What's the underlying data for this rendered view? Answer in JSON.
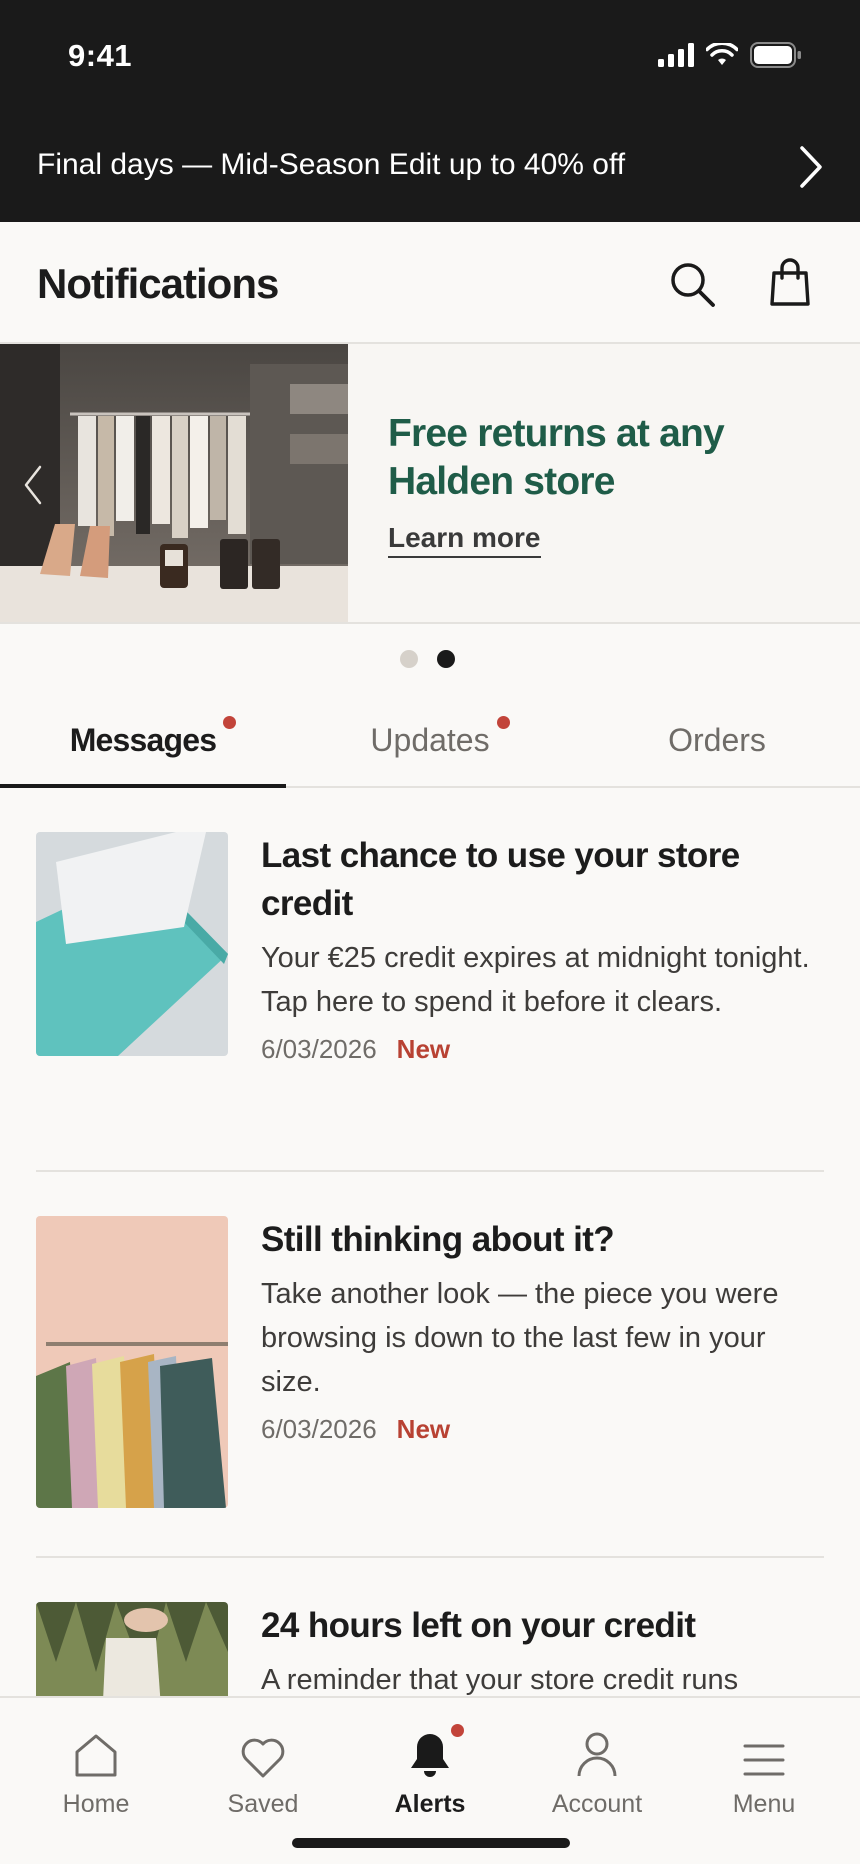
{
  "status_bar": {
    "time": "9:41"
  },
  "promo_bar": {
    "text": "Final days — Mid-Season Edit up to 40% off"
  },
  "header": {
    "title": "Notifications"
  },
  "banner": {
    "headline": "Free returns at any Halden store",
    "link_label": "Learn more",
    "slide_count": 2,
    "active_slide": 2
  },
  "tabs": [
    {
      "label": "Messages",
      "active": true,
      "unread": true
    },
    {
      "label": "Updates",
      "active": false,
      "unread": true
    },
    {
      "label": "Orders",
      "active": false,
      "unread": false
    }
  ],
  "notifications": [
    {
      "title": "Last chance to use your store credit",
      "body": "Your €25 credit expires at midnight tonight. Tap here to spend it before it clears.",
      "date": "6/03/2026",
      "badge": "New",
      "image": "teal-gift-box-with-card"
    },
    {
      "title": "Still thinking about it?",
      "body": "Take another look — the piece you were browsing is down to the last few in your size.",
      "date": "6/03/2026",
      "badge": "New",
      "image": "clothing-rail-pink-wall"
    },
    {
      "title": "24 hours left on your credit",
      "body": "A reminder that your store credit runs",
      "image": "hand-holding-shopping-bag"
    }
  ],
  "bottom_nav": [
    {
      "label": "Home",
      "icon": "home-icon"
    },
    {
      "label": "Saved",
      "icon": "heart-icon"
    },
    {
      "label": "Alerts",
      "icon": "bell-icon",
      "active": true,
      "badge": true
    },
    {
      "label": "Account",
      "icon": "person-icon"
    },
    {
      "label": "Menu",
      "icon": "menu-icon"
    }
  ],
  "colors": {
    "accent_green": "#1f5c48",
    "badge_red": "#c2443a",
    "new_label": "#b84233",
    "dark_bar": "#1a1a1a",
    "background": "#faf9f7"
  }
}
